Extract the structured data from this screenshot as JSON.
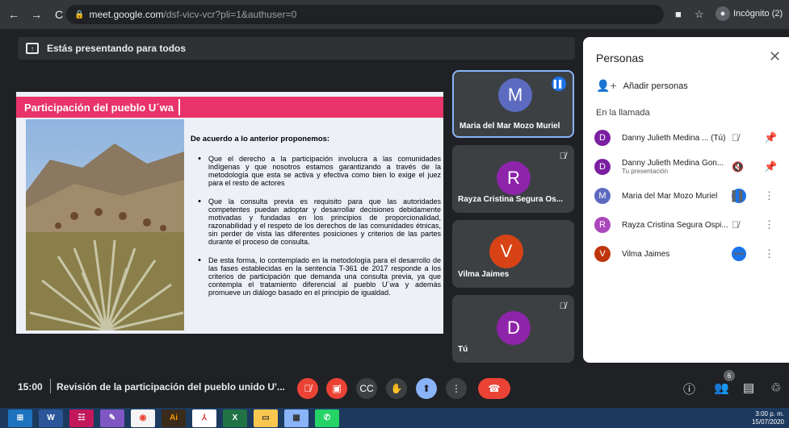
{
  "browser": {
    "url_host": "meet.google.com",
    "url_path": "/dsf-vicv-vcr?pli=1&authuser=0",
    "profile": "Incógnito (2)"
  },
  "banner": {
    "text": "Estás presentando para todos"
  },
  "slide": {
    "title": "Participación del pueblo U´wa",
    "intro": "De acuerdo a lo anterior proponemos:",
    "bullets": [
      "Que el derecho a la participación involucra a las comunidades indígenas y que nosotros estamos garantizando a través de la metodología que esta se activa y efectiva como bien lo exige el juez para el resto de actores",
      "Que la consulta previa es requisito para que las autoridades competentes puedan adoptar y desarrollar decisiones debidamente motivadas y fundadas en los principios de proporcionalidad, razonabilidad y el respeto de los derechos de las comunidades étnicas, sin perder de vista las diferentes posiciones y criterios de las partes durante el proceso de consulta.",
      "De esta forma, lo contemplado en la metodología para el desarrollo de las fases establecidas en la sentencia T-361 de 2017 responde a los criterios de participación que demanda una consulta previa, ya que contempla el tratamiento diferencial al pueblo U´wa y además promueve un diálogo basado en el principio de igualdad."
    ]
  },
  "tiles": [
    {
      "initial": "M",
      "name": "Maria del Mar Mozo Muriel",
      "color": "#5c6bc0"
    },
    {
      "initial": "R",
      "name": "Rayza Cristina Segura Os...",
      "color": "#8e24aa"
    },
    {
      "initial": "V",
      "name": "Vilma Jaimes",
      "color": "#d84315"
    },
    {
      "initial": "D",
      "name": "Tú",
      "color": "#8e24aa"
    }
  ],
  "panel": {
    "title": "Personas",
    "add_label": "Añadir personas",
    "section": "En la llamada",
    "people": [
      {
        "initial": "D",
        "name": "Danny Julieth Medina ...",
        "suffix": "(Tú)",
        "sub": "",
        "color": "#7b1fa2"
      },
      {
        "initial": "D",
        "name": "Danny Julieth Medina Gon...",
        "suffix": "",
        "sub": "Tu presentación",
        "color": "#7b1fa2"
      },
      {
        "initial": "M",
        "name": "Maria del Mar Mozo Muriel",
        "suffix": "",
        "sub": "",
        "color": "#5c6bc0"
      },
      {
        "initial": "R",
        "name": "Rayza Cristina Segura Ospi...",
        "suffix": "",
        "sub": "",
        "color": "#ab47bc"
      },
      {
        "initial": "V",
        "name": "Vilma Jaimes",
        "suffix": "",
        "sub": "",
        "color": "#bf360c"
      }
    ]
  },
  "bottom": {
    "time": "15:00",
    "meeting_title": "Revisión de la participación del pueblo unido U'...",
    "people_count": "6"
  },
  "taskbar": {
    "time": "3:00 p. m.",
    "date": "15/07/2020"
  }
}
